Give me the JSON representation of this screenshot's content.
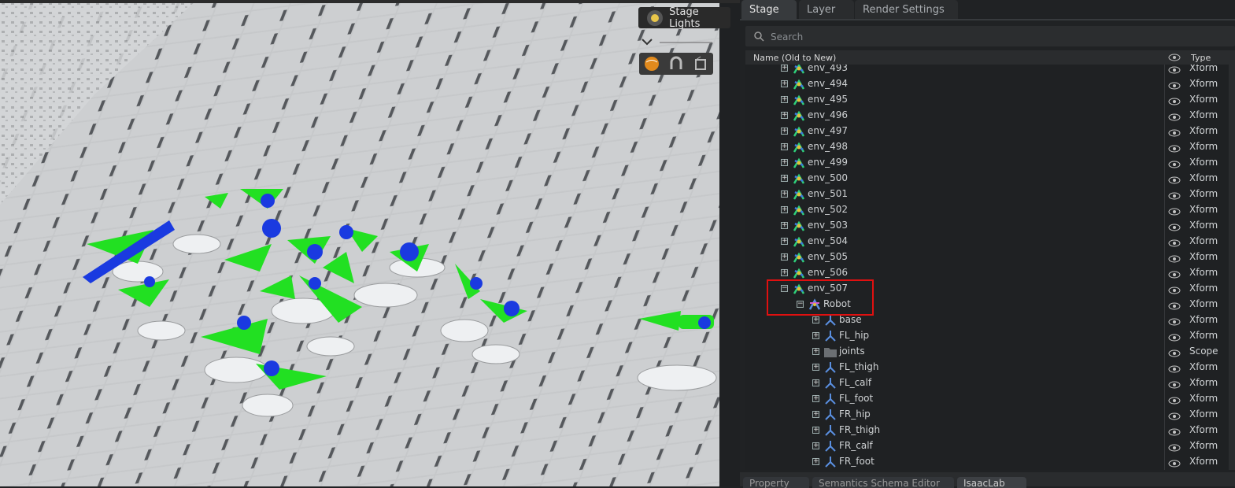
{
  "viewport": {
    "stage_lights_label": "Stage Lights",
    "icons": [
      "sun-icon",
      "globe-icon",
      "magnet-icon",
      "camera-cube-icon"
    ]
  },
  "stage_panel": {
    "tabs": [
      {
        "label": "Stage",
        "active": true
      },
      {
        "label": "Layer",
        "active": false
      },
      {
        "label": "Render Settings",
        "active": false
      }
    ],
    "search": {
      "placeholder": "Search",
      "value": ""
    },
    "columns": {
      "name": "Name (Old to New)",
      "type": "Type"
    },
    "rows": [
      {
        "name": "env_493",
        "type": "Xform",
        "icon": "xform-icon",
        "level": 0,
        "expanded": false
      },
      {
        "name": "env_494",
        "type": "Xform",
        "icon": "xform-icon",
        "level": 0,
        "expanded": false
      },
      {
        "name": "env_495",
        "type": "Xform",
        "icon": "xform-icon",
        "level": 0,
        "expanded": false
      },
      {
        "name": "env_496",
        "type": "Xform",
        "icon": "xform-icon",
        "level": 0,
        "expanded": false
      },
      {
        "name": "env_497",
        "type": "Xform",
        "icon": "xform-icon",
        "level": 0,
        "expanded": false
      },
      {
        "name": "env_498",
        "type": "Xform",
        "icon": "xform-icon",
        "level": 0,
        "expanded": false
      },
      {
        "name": "env_499",
        "type": "Xform",
        "icon": "xform-icon",
        "level": 0,
        "expanded": false
      },
      {
        "name": "env_500",
        "type": "Xform",
        "icon": "xform-icon",
        "level": 0,
        "expanded": false
      },
      {
        "name": "env_501",
        "type": "Xform",
        "icon": "xform-icon",
        "level": 0,
        "expanded": false
      },
      {
        "name": "env_502",
        "type": "Xform",
        "icon": "xform-icon",
        "level": 0,
        "expanded": false
      },
      {
        "name": "env_503",
        "type": "Xform",
        "icon": "xform-icon",
        "level": 0,
        "expanded": false
      },
      {
        "name": "env_504",
        "type": "Xform",
        "icon": "xform-icon",
        "level": 0,
        "expanded": false
      },
      {
        "name": "env_505",
        "type": "Xform",
        "icon": "xform-icon",
        "level": 0,
        "expanded": false
      },
      {
        "name": "env_506",
        "type": "Xform",
        "icon": "xform-icon",
        "level": 0,
        "expanded": false
      },
      {
        "name": "env_507",
        "type": "Xform",
        "icon": "xform-icon",
        "level": 0,
        "expanded": true
      },
      {
        "name": "Robot",
        "type": "Xform",
        "icon": "robot-icon",
        "level": 1,
        "expanded": true
      },
      {
        "name": "base",
        "type": "Xform",
        "icon": "axes-icon",
        "level": 2,
        "expanded": false
      },
      {
        "name": "FL_hip",
        "type": "Xform",
        "icon": "axes-icon",
        "level": 2,
        "expanded": false
      },
      {
        "name": "joints",
        "type": "Scope",
        "icon": "folder-icon",
        "level": 2,
        "expanded": false
      },
      {
        "name": "FL_thigh",
        "type": "Xform",
        "icon": "axes-icon",
        "level": 2,
        "expanded": false
      },
      {
        "name": "FL_calf",
        "type": "Xform",
        "icon": "axes-icon",
        "level": 2,
        "expanded": false
      },
      {
        "name": "FL_foot",
        "type": "Xform",
        "icon": "axes-icon",
        "level": 2,
        "expanded": false
      },
      {
        "name": "FR_hip",
        "type": "Xform",
        "icon": "axes-icon",
        "level": 2,
        "expanded": false
      },
      {
        "name": "FR_thigh",
        "type": "Xform",
        "icon": "axes-icon",
        "level": 2,
        "expanded": false
      },
      {
        "name": "FR_calf",
        "type": "Xform",
        "icon": "axes-icon",
        "level": 2,
        "expanded": false
      },
      {
        "name": "FR_foot",
        "type": "Xform",
        "icon": "axes-icon",
        "level": 2,
        "expanded": false
      }
    ],
    "highlighted_rows": [
      "env_507",
      "Robot"
    ],
    "bottom_tabs": [
      "Property",
      "Semantics Schema Editor",
      "IsaacLab"
    ]
  },
  "colors": {
    "highlight": "#e01010",
    "arrow_green": "#22e022",
    "arrow_blue": "#1a3ae0"
  }
}
